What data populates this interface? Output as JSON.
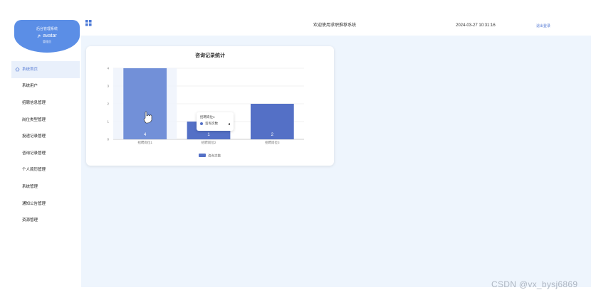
{
  "brand": {
    "system_name": "后台管理系统",
    "avatar_text": "avatar",
    "user_role": "管理员"
  },
  "menu": [
    {
      "label": "系统首页"
    },
    {
      "label": "系统用户"
    },
    {
      "label": "招聘信息管理"
    },
    {
      "label": "岗位类型管理"
    },
    {
      "label": "投递记录管理"
    },
    {
      "label": "咨询记录管理"
    },
    {
      "label": "个人简历管理"
    },
    {
      "label": "系统管理"
    },
    {
      "label": "通知公告管理"
    },
    {
      "label": "资源管理"
    }
  ],
  "header": {
    "welcome": "欢迎使用求职推荐系统",
    "datetime": "2024-03-27 10:31:16",
    "logout": "退出登录"
  },
  "chart_data": {
    "type": "bar",
    "title": "咨询记录统计",
    "categories": [
      "招聘岗位1",
      "招聘岗位2",
      "招聘岗位3"
    ],
    "series": [
      {
        "name": "咨询次数",
        "values": [
          4,
          1,
          2
        ]
      }
    ],
    "ylim": [
      0,
      4
    ],
    "y_ticks": [
      "0",
      "1",
      "2",
      "3",
      "4"
    ],
    "grid": true,
    "legend": "bottom",
    "colors": {
      "bar": "#5470c6",
      "bar_hover": "#7290d8"
    }
  },
  "tooltip": {
    "title": "招聘岗位1",
    "series_name": "咨询次数",
    "value": "4"
  },
  "watermark": "CSDN @vx_bysj6869"
}
